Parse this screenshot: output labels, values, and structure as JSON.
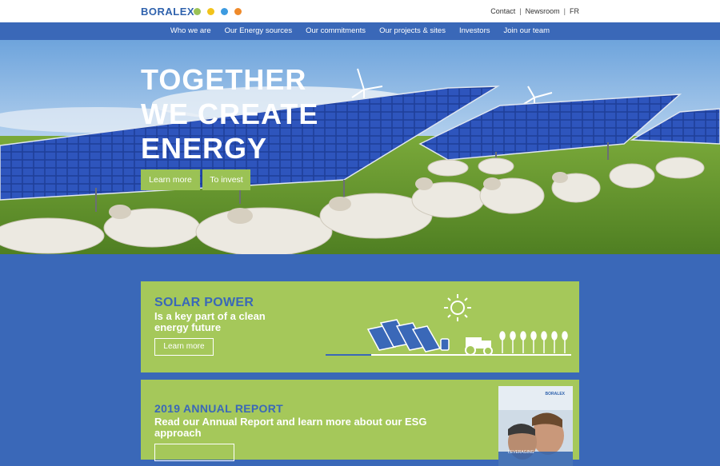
{
  "header": {
    "logo": "BORALEX",
    "dots": [
      {
        "name": "green-energy-icon",
        "color": "#9bc255"
      },
      {
        "name": "sun-energy-icon",
        "color": "#f2c31b"
      },
      {
        "name": "water-energy-icon",
        "color": "#3d9be0"
      },
      {
        "name": "fire-energy-icon",
        "color": "#ef8a2a"
      }
    ],
    "links": [
      "Contact",
      "Newsroom",
      "FR"
    ],
    "separator": "|"
  },
  "nav": [
    "Who we are",
    "Our Energy sources",
    "Our commitments",
    "Our projects & sites",
    "Investors",
    "Join our team"
  ],
  "hero": {
    "title_lines": [
      "TOGETHER",
      "WE CREATE",
      "ENERGY"
    ],
    "buttons": [
      "Learn more",
      "To invest"
    ]
  },
  "solar_card": {
    "kicker": "SOLAR POWER",
    "text_lines": [
      "Is a key part of a clean",
      "energy future"
    ],
    "button": "Learn more"
  },
  "report_card": {
    "kicker": "2019 ANNUAL REPORT",
    "text_lines": [
      "Read our Annual Report and learn more about our ESG",
      "approach"
    ],
    "cover_logo": "BORALEX",
    "cover_caption": "LEVERAGING"
  },
  "colors": {
    "brand_blue": "#3a68b8",
    "brand_green": "#a5c85a",
    "button_green": "#9bc255"
  }
}
